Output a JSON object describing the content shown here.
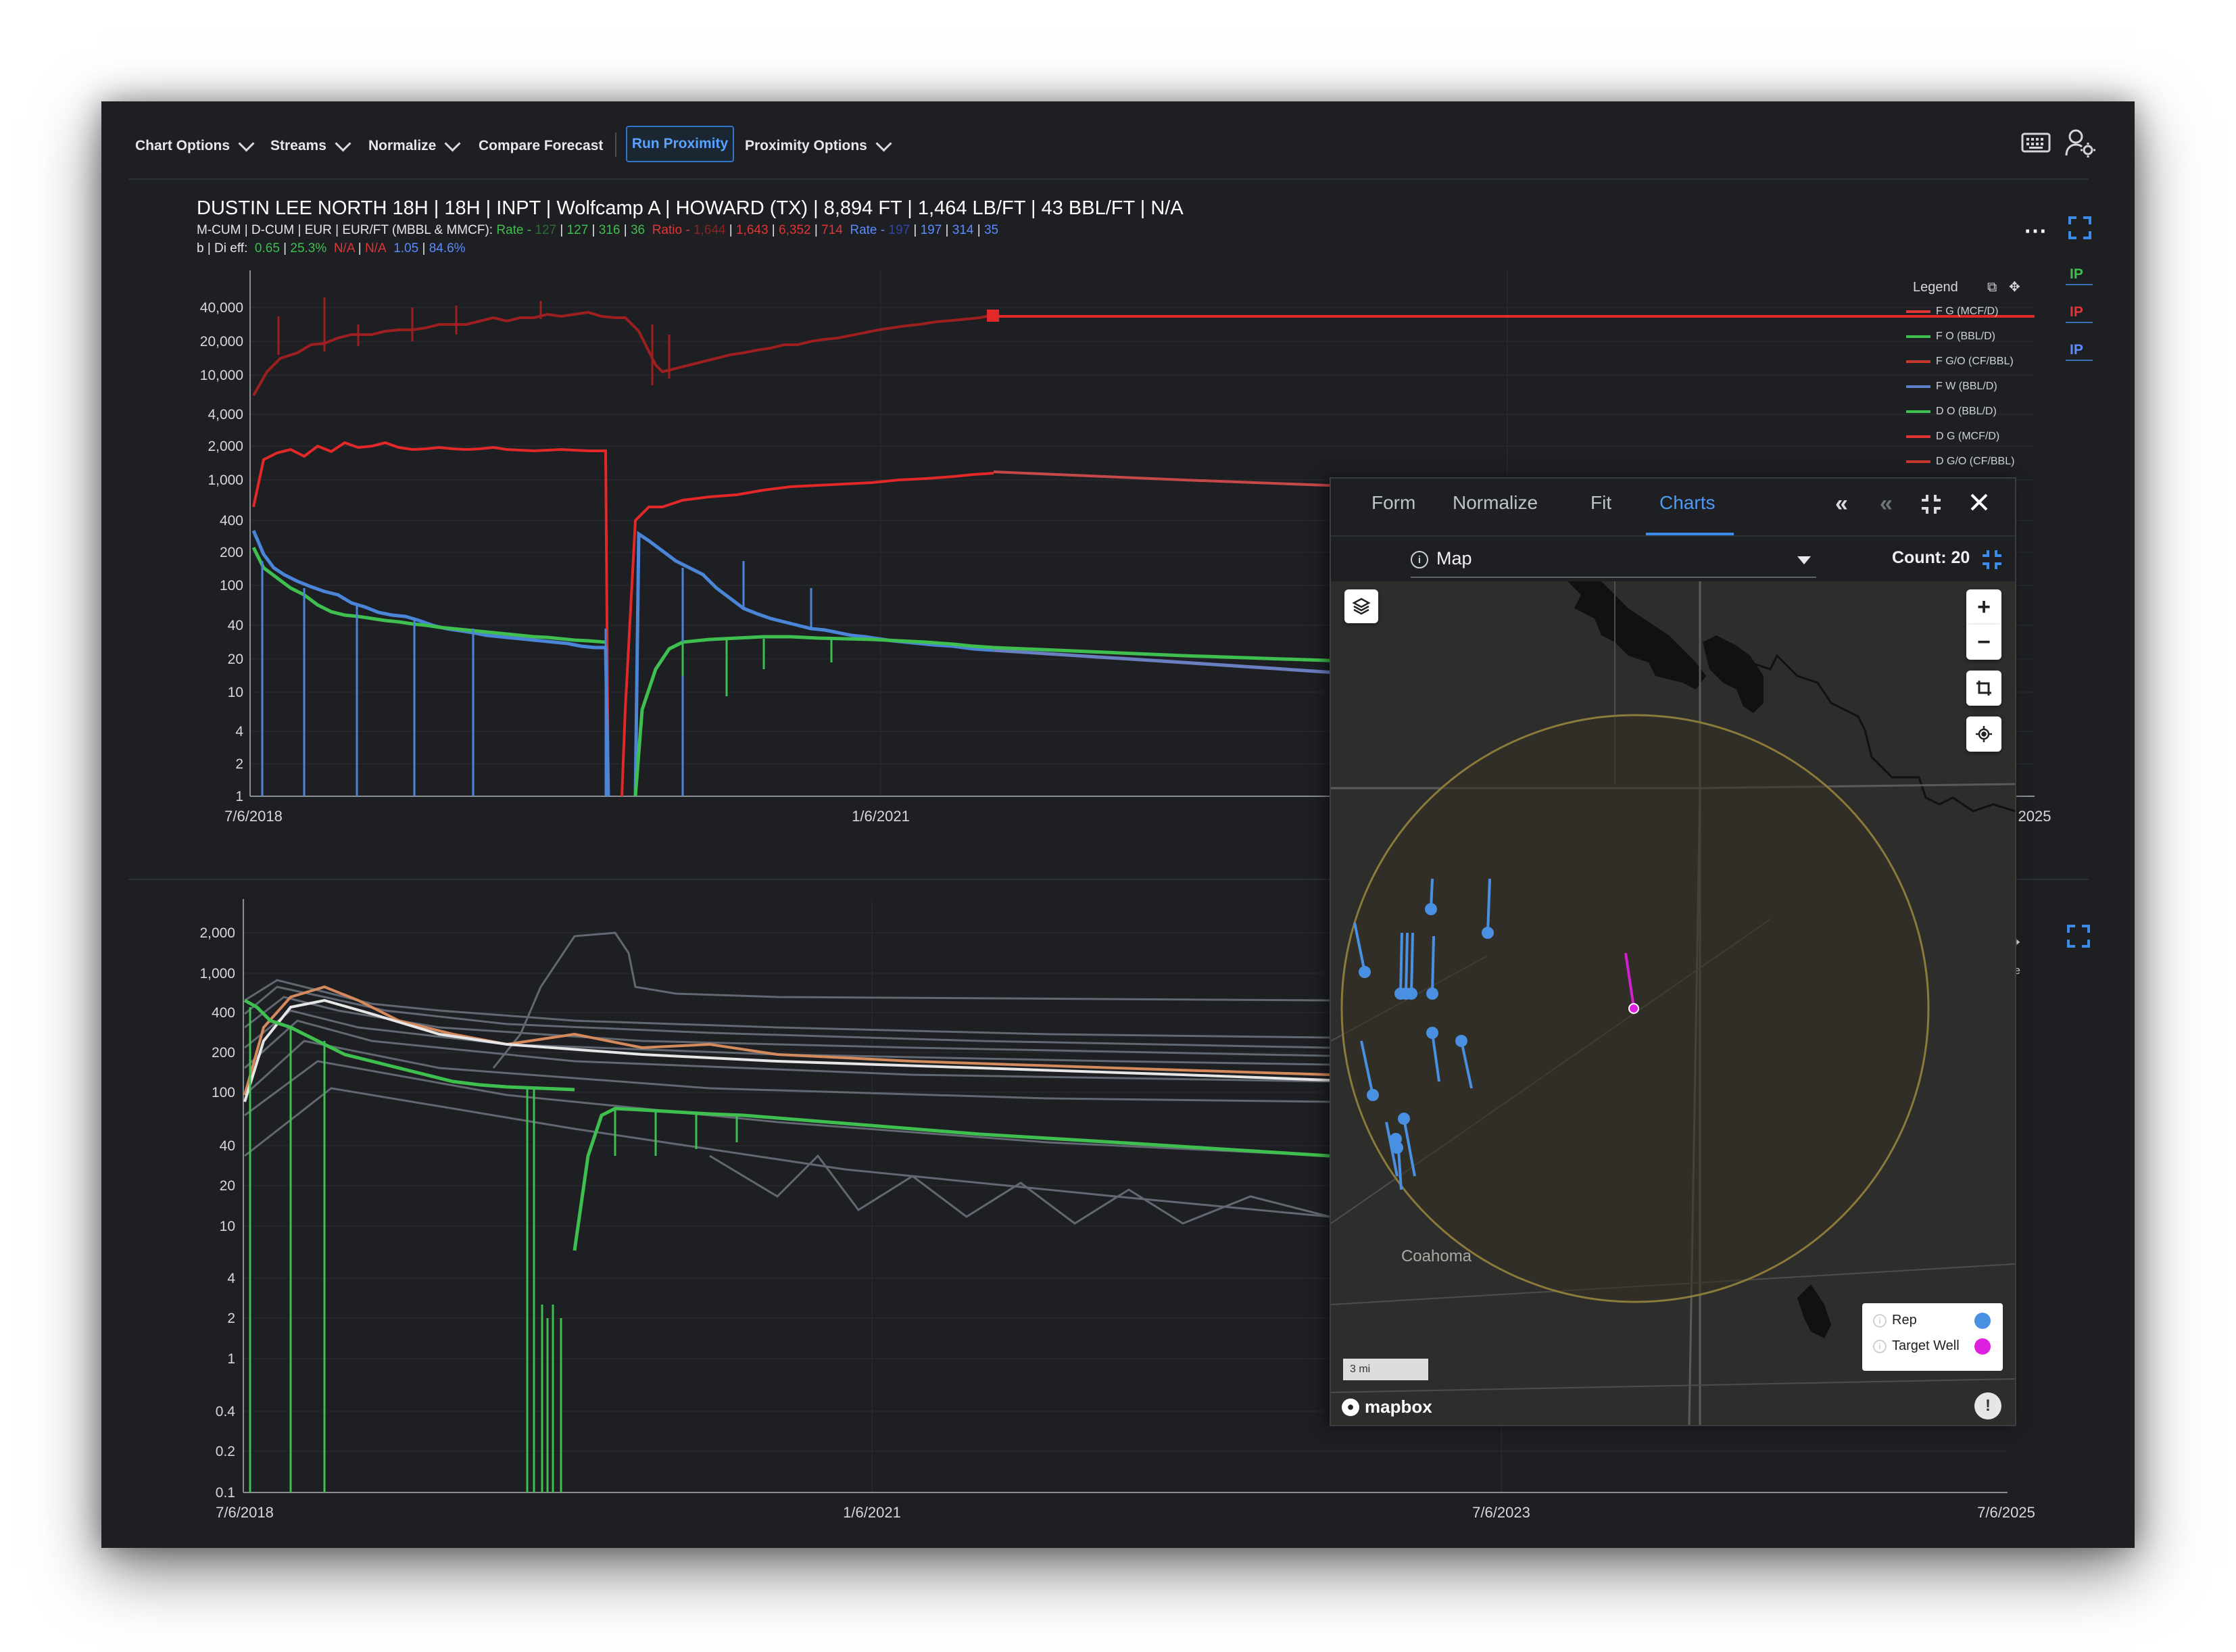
{
  "toolbar": {
    "chart_options": "Chart Options",
    "streams": "Streams",
    "normalize": "Normalize",
    "compare_forecast": "Compare Forecast",
    "run_proximity": "Run Proximity",
    "proximity_options": "Proximity Options"
  },
  "well_info": {
    "title": "DUSTIN LEE NORTH 18H | 18H | INPT | Wolfcamp A | HOWARD (TX) | 8,894 FT | 1,464 LB/FT | 43 BBL/FT | N/A",
    "line2": {
      "prefix": "M-CUM | D-CUM | EUR | EUR/FT (MBBL & MMCF):",
      "rate_label": "Rate -",
      "rate_values": [
        "127",
        "127",
        "316",
        "36"
      ],
      "ratio_label": "Ratio -",
      "ratio_values": [
        "1,644",
        "1,643",
        "6,352",
        "714"
      ],
      "rate2_label": "Rate -",
      "rate2_values": [
        "197",
        "197",
        "314",
        "35"
      ]
    },
    "line3": {
      "prefix": "b | Di eff:",
      "green_b": "0.65",
      "green_di": "25.3%",
      "red_b": "N/A",
      "red_di": "N/A",
      "blue_b": "1.05",
      "blue_di": "84.6%"
    }
  },
  "top_chart": {
    "y_ticks": [
      "40,000",
      "20,000",
      "10,000",
      "4,000",
      "2,000",
      "1,000",
      "400",
      "200",
      "100",
      "40",
      "20",
      "10",
      "4",
      "2",
      "1"
    ],
    "x_ticks": [
      "7/6/2018",
      "1/6/2021",
      "2025"
    ],
    "legend": {
      "title": "Legend",
      "items": [
        {
          "label": "F G (MCF/D)",
          "color": "#e03535"
        },
        {
          "label": "F O (BBL/D)",
          "color": "#3fbf4f"
        },
        {
          "label": "F G/O (CF/BBL)",
          "color": "#c8382e"
        },
        {
          "label": "F W (BBL/D)",
          "color": "#5b7fc9"
        },
        {
          "label": "D O (BBL/D)",
          "color": "#3fbf4f"
        },
        {
          "label": "D G (MCF/D)",
          "color": "#e03535"
        },
        {
          "label": "D G/O (CF/BBL)",
          "color": "#c8382e"
        }
      ]
    },
    "ip_tags": [
      {
        "label": "IP",
        "color": "#3fbf4f"
      },
      {
        "label": "IP",
        "color": "#e03535"
      },
      {
        "label": "IP",
        "color": "#5b8bff"
      }
    ]
  },
  "bottom_chart": {
    "y_ticks": [
      "2,000",
      "1,000",
      "400",
      "200",
      "100",
      "40",
      "20",
      "10",
      "4",
      "2",
      "1",
      "0.4",
      "0.2",
      "0.1"
    ],
    "x_ticks": [
      "7/6/2018",
      "1/6/2021",
      "7/6/2023",
      "7/6/2025"
    ],
    "legend_fragment": "ge"
  },
  "panel": {
    "tabs": [
      "Form",
      "Normalize",
      "Fit",
      "Charts"
    ],
    "active_tab": "Charts",
    "map_select_label": "Map",
    "count_label": "Count: 20",
    "map": {
      "town_label": "Coahoma",
      "scale_label": "3 mi",
      "brand": "mapbox",
      "legend": [
        {
          "label": "Rep",
          "color": "#4a90e2"
        },
        {
          "label": "Target Well",
          "color": "#e020e0"
        }
      ],
      "zoom_in": "+",
      "zoom_out": "−"
    }
  },
  "icons": {
    "keyboard": "keyboard-icon",
    "user_settings": "user-settings-icon",
    "more": "more-icon",
    "expand": "expand-icon",
    "layers": "layers-icon",
    "info": "info-icon"
  }
}
